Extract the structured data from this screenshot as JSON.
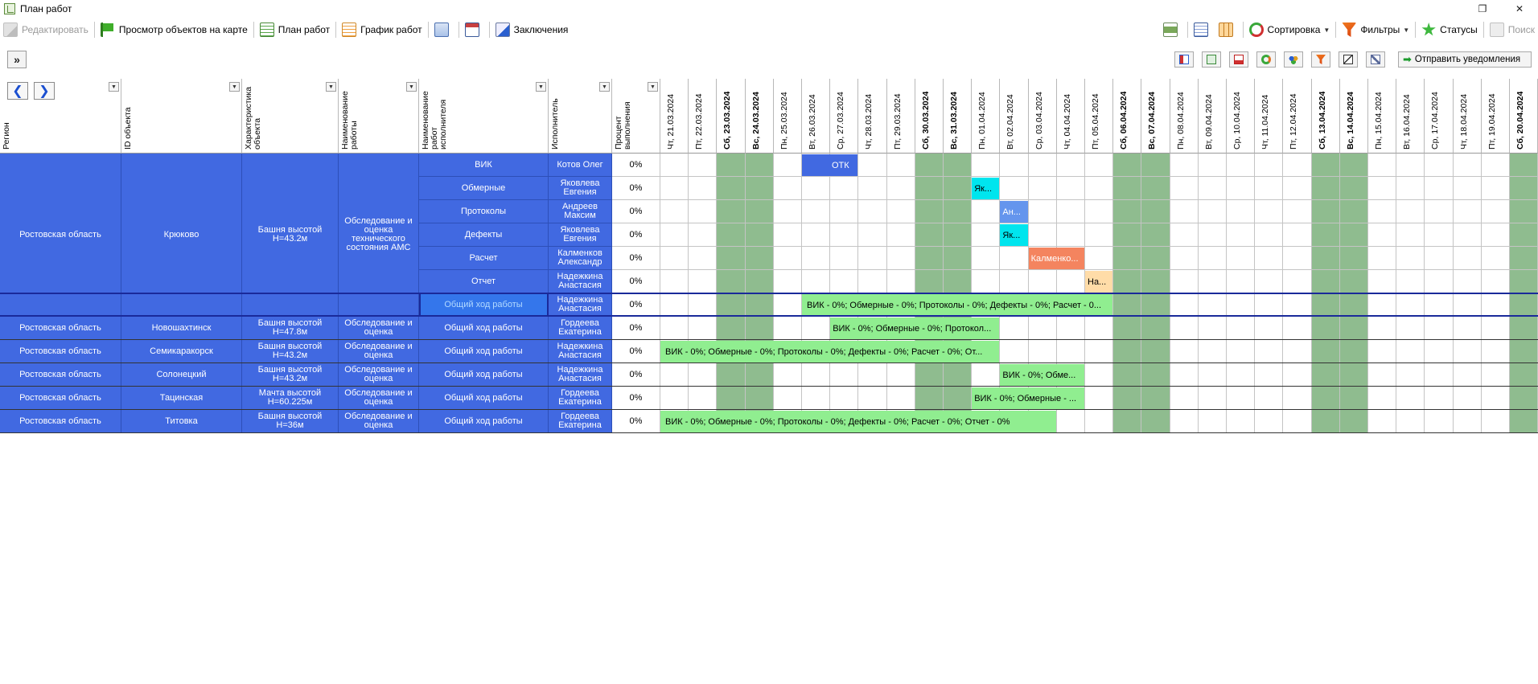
{
  "window": {
    "title": "План работ",
    "restore": "❐",
    "close": "✕"
  },
  "toolbar": {
    "edit": "Редактировать",
    "map_view": "Просмотр объектов на карте",
    "work_plan": "План работ",
    "work_schedule": "График работ",
    "conclusions": "Заключения",
    "sorting": "Сортировка",
    "filters": "Фильтры",
    "statuses": "Статусы",
    "search": "Поиск"
  },
  "toolbar2": {
    "expand": "»",
    "send_notifications": "Отправить уведомления"
  },
  "headers": {
    "region": "Регион",
    "object_id": "ID объекта",
    "object_char": "Характеристика объекта",
    "work_name": "Наименование работы",
    "executor_work_name": "Наименование работ исполнителя",
    "executor": "Исполнитель",
    "percent": "Процент выполнения"
  },
  "dates": [
    {
      "label": "Чт, 21.03.2024",
      "weekend": false
    },
    {
      "label": "Пт, 22.03.2024",
      "weekend": false
    },
    {
      "label": "Сб, 23.03.2024",
      "weekend": true
    },
    {
      "label": "Вс, 24.03.2024",
      "weekend": true
    },
    {
      "label": "Пн, 25.03.2024",
      "weekend": false
    },
    {
      "label": "Вт, 26.03.2024",
      "weekend": false
    },
    {
      "label": "Ср, 27.03.2024",
      "weekend": false
    },
    {
      "label": "Чт, 28.03.2024",
      "weekend": false
    },
    {
      "label": "Пт, 29.03.2024",
      "weekend": false
    },
    {
      "label": "Сб, 30.03.2024",
      "weekend": true
    },
    {
      "label": "Вс, 31.03.2024",
      "weekend": true
    },
    {
      "label": "Пн, 01.04.2024",
      "weekend": false
    },
    {
      "label": "Вт, 02.04.2024",
      "weekend": false
    },
    {
      "label": "Ср, 03.04.2024",
      "weekend": false
    },
    {
      "label": "Чт, 04.04.2024",
      "weekend": false
    },
    {
      "label": "Пт, 05.04.2024",
      "weekend": false
    },
    {
      "label": "Сб, 06.04.2024",
      "weekend": true
    },
    {
      "label": "Вс, 07.04.2024",
      "weekend": true
    },
    {
      "label": "Пн, 08.04.2024",
      "weekend": false
    },
    {
      "label": "Вт, 09.04.2024",
      "weekend": false
    },
    {
      "label": "Ср, 10.04.2024",
      "weekend": false
    },
    {
      "label": "Чт, 11.04.2024",
      "weekend": false
    },
    {
      "label": "Пт, 12.04.2024",
      "weekend": false
    },
    {
      "label": "Сб, 13.04.2024",
      "weekend": true
    },
    {
      "label": "Вс, 14.04.2024",
      "weekend": true
    },
    {
      "label": "Пн, 15.04.2024",
      "weekend": false
    },
    {
      "label": "Вт, 16.04.2024",
      "weekend": false
    },
    {
      "label": "Ср, 17.04.2024",
      "weekend": false
    },
    {
      "label": "Чт, 18.04.2024",
      "weekend": false
    },
    {
      "label": "Пт, 19.04.2024",
      "weekend": false
    },
    {
      "label": "Сб, 20.04.2024",
      "weekend": true
    }
  ],
  "groups": [
    {
      "region": "Ростовская область",
      "object_id": "Крюково",
      "object_char": "Башня высотой Н=43.2м",
      "work_name": "Обследование и оценка технического состояния АМС",
      "rows": [
        {
          "task": "ВИК",
          "executor": "Котов Олег",
          "percent": "0%",
          "bar": {
            "start": 5,
            "span": 2,
            "text": "ОТК",
            "color": "#4169e1",
            "fg": "#fff",
            "icon": true
          }
        },
        {
          "task": "Обмерные",
          "executor": "Яковлева Евгения",
          "percent": "0%",
          "bar": {
            "start": 11,
            "span": 1,
            "text": "Як...",
            "color": "#00e5ee",
            "fg": "#000"
          }
        },
        {
          "task": "Протоколы",
          "executor": "Андреев Максим",
          "percent": "0%",
          "bar": {
            "start": 12,
            "span": 1,
            "text": "Ан...",
            "color": "#6495ed",
            "fg": "#fff"
          }
        },
        {
          "task": "Дефекты",
          "executor": "Яковлева Евгения",
          "percent": "0%",
          "bar": {
            "start": 12,
            "span": 1,
            "text": "Як...",
            "color": "#00e5ee",
            "fg": "#000"
          }
        },
        {
          "task": "Расчет",
          "executor": "Калменков Александр",
          "percent": "0%",
          "bar": {
            "start": 13,
            "span": 2,
            "text": "Калменко...",
            "color": "#f4845f",
            "fg": "#fff"
          }
        },
        {
          "task": "Отчет",
          "executor": "Надежкина Анастасия",
          "percent": "0%",
          "bar": {
            "start": 15,
            "span": 1,
            "text": "На...",
            "color": "#ffdca8",
            "fg": "#000"
          }
        },
        {
          "task": "Общий ход работы",
          "executor": "Надежкина Анастасия",
          "percent": "0%",
          "bar": {
            "start": 5,
            "span": 11,
            "text": "ВИК - 0%; Обмерные - 0%; Протоколы - 0%; Дефекты - 0%; Расчет - 0...",
            "color": "#90ee90",
            "fg": "#000"
          }
        }
      ]
    },
    {
      "region": "Ростовская область",
      "object_id": "Новошахтинск",
      "object_char": "Башня высотой Н=47.8м",
      "work_name": "Обследование и оценка",
      "rows": [
        {
          "task": "Общий ход работы",
          "executor": "Гордеева Екатерина",
          "percent": "0%",
          "bar": {
            "start": 6,
            "span": 6,
            "text": "ВИК - 0%; Обмерные - 0%; Протокол...",
            "color": "#90ee90",
            "fg": "#000"
          }
        }
      ]
    },
    {
      "region": "Ростовская область",
      "object_id": "Семикаракорск",
      "object_char": "Башня высотой Н=43.2м",
      "work_name": "Обследование и оценка",
      "rows": [
        {
          "task": "Общий ход работы",
          "executor": "Надежкина Анастасия",
          "percent": "0%",
          "bar": {
            "start": 0,
            "span": 12,
            "text": "ВИК - 0%; Обмерные - 0%; Протоколы - 0%; Дефекты - 0%; Расчет - 0%; От...",
            "color": "#90ee90",
            "fg": "#000"
          }
        }
      ]
    },
    {
      "region": "Ростовская область",
      "object_id": "Солонецкий",
      "object_char": "Башня высотой Н=43.2м",
      "work_name": "Обследование и оценка",
      "rows": [
        {
          "task": "Общий ход работы",
          "executor": "Надежкина Анастасия",
          "percent": "0%",
          "bar": {
            "start": 12,
            "span": 3,
            "text": "ВИК - 0%; Обме...",
            "color": "#90ee90",
            "fg": "#000"
          }
        }
      ]
    },
    {
      "region": "Ростовская область",
      "object_id": "Тацинская",
      "object_char": "Мачта высотой Н=60.225м",
      "work_name": "Обследование и оценка",
      "rows": [
        {
          "task": "Общий ход работы",
          "executor": "Гордеева Екатерина",
          "percent": "0%",
          "bar": {
            "start": 11,
            "span": 4,
            "text": "ВИК - 0%; Обмерные - ...",
            "color": "#90ee90",
            "fg": "#000"
          }
        }
      ]
    },
    {
      "region": "Ростовская область",
      "object_id": "Титовка",
      "object_char": "Башня высотой Н=36м",
      "work_name": "Обследование и оценка",
      "rows": [
        {
          "task": "Общий ход работы",
          "executor": "Гордеева Екатерина",
          "percent": "0%",
          "bar": {
            "start": 0,
            "span": 14,
            "text": "ВИК - 0%; Обмерные - 0%; Протоколы - 0%; Дефекты - 0%; Расчет - 0%; Отчет - 0%",
            "color": "#90ee90",
            "fg": "#000"
          }
        }
      ]
    }
  ]
}
